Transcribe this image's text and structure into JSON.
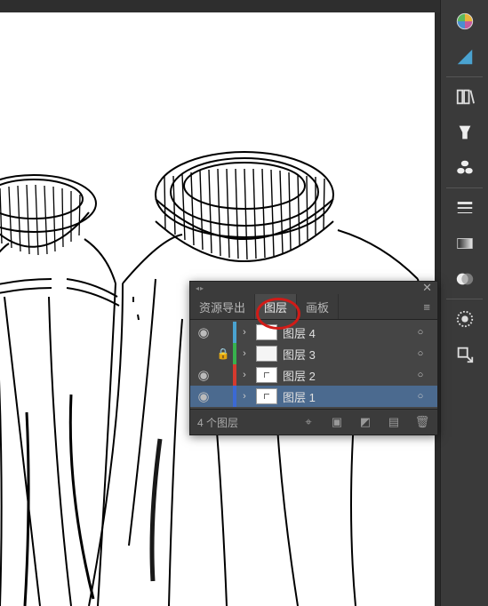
{
  "panel": {
    "tabs": {
      "export": "资源导出",
      "layers": "图层",
      "artboards": "画板"
    },
    "layers": [
      {
        "name": "图层 4",
        "colorHex": "#4aa3d1"
      },
      {
        "name": "图层 3",
        "colorHex": "#37b24d"
      },
      {
        "name": "图层 2",
        "colorHex": "#d63a2e"
      },
      {
        "name": "图层 1",
        "colorHex": "#3b69d4"
      }
    ],
    "status": {
      "count": "4 个图层"
    }
  },
  "toolbar": {
    "tools": [
      "color-picker",
      "shape",
      "brush",
      "symbol",
      "suit",
      "align",
      "gradient",
      "appearance",
      "dotted",
      "export"
    ]
  }
}
